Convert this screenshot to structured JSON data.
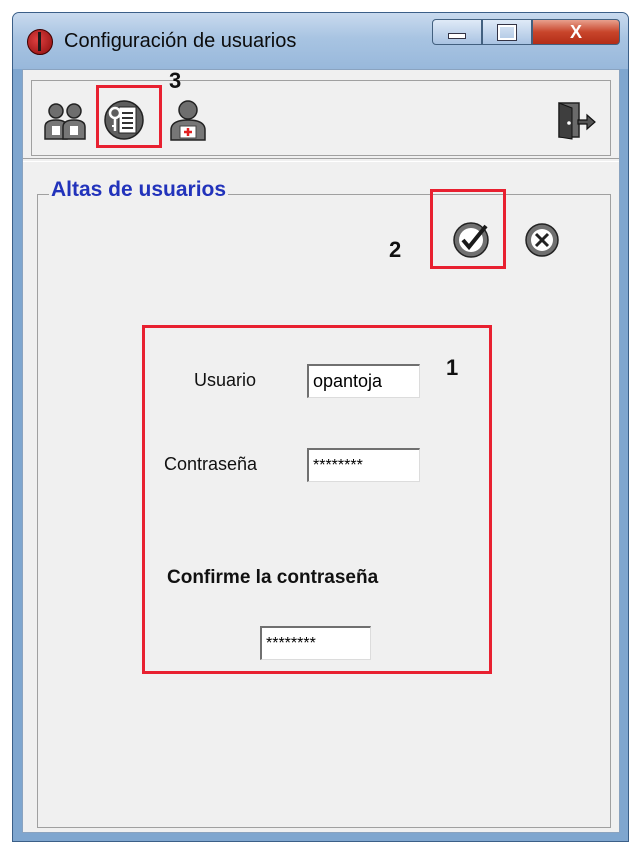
{
  "window": {
    "title": "Configuración de usuarios",
    "close_label": "X",
    "app_icon": "ladybug-icon"
  },
  "toolbar": {
    "items": [
      {
        "icon": "users-icon"
      },
      {
        "icon": "user-keys-icon"
      },
      {
        "icon": "add-user-icon"
      },
      {
        "icon": "exit-door-icon"
      }
    ]
  },
  "section": {
    "title": "Altas de usuarios",
    "accept_icon": "checkmark-icon",
    "cancel_icon": "cancel-x-icon"
  },
  "form": {
    "user_label": "Usuario",
    "user_value": "opantoja",
    "password_label": "Contraseña",
    "password_value": "********",
    "confirm_label": "Confirme la contraseña",
    "confirm_value": "********"
  },
  "annotations": {
    "form_number": "1",
    "accept_number": "2",
    "toolbar_number": "3",
    "color": "#e82030"
  }
}
